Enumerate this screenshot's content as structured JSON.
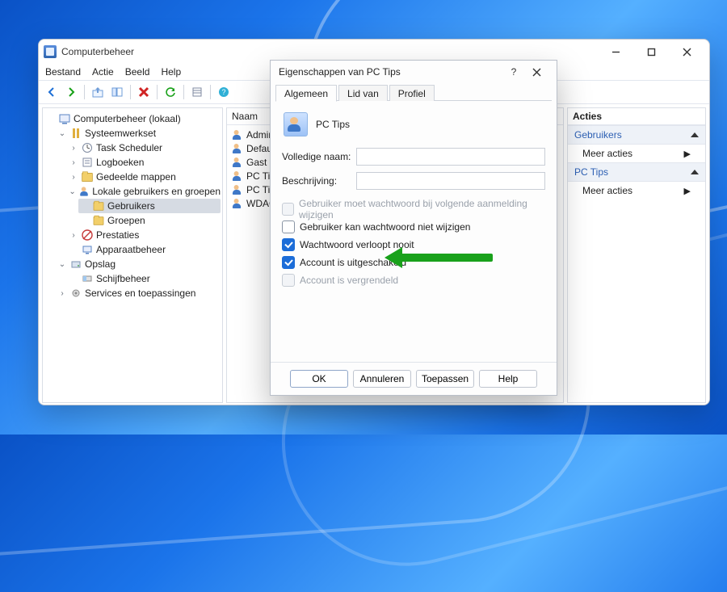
{
  "window": {
    "title": "Computerbeheer"
  },
  "menu": {
    "file": "Bestand",
    "action": "Actie",
    "view": "Beeld",
    "help": "Help"
  },
  "tree": {
    "root": "Computerbeheer (lokaal)",
    "system_tools": "Systeemwerkset",
    "task_scheduler": "Task Scheduler",
    "logs": "Logboeken",
    "shared_folders": "Gedeelde mappen",
    "local_users_groups": "Lokale gebruikers en groepen",
    "users": "Gebruikers",
    "groups": "Groepen",
    "performance": "Prestaties",
    "device_mgr": "Apparaatbeheer",
    "storage": "Opslag",
    "disk_mgmt": "Schijfbeheer",
    "services_apps": "Services en toepassingen"
  },
  "list": {
    "header": "Naam",
    "items": [
      "Admin",
      "Defaul",
      "Gast",
      "PC Tips",
      "PC Tips",
      "WDAG"
    ]
  },
  "actions": {
    "header": "Acties",
    "group1": "Gebruikers",
    "group2": "PC Tips",
    "more": "Meer acties"
  },
  "dialog": {
    "title": "Eigenschappen van PC Tips",
    "tabs": {
      "general": "Algemeen",
      "member_of": "Lid van",
      "profile": "Profiel"
    },
    "user_name": "PC Tips",
    "full_name_label": "Volledige naam:",
    "full_name_value": "",
    "description_label": "Beschrijving:",
    "description_value": "",
    "chk_change_next": "Gebruiker moet wachtwoord bij volgende aanmelding wijzigen",
    "chk_cannot_change": "Gebruiker kan wachtwoord niet wijzigen",
    "chk_never_expires": "Wachtwoord verloopt nooit",
    "chk_disabled": "Account is uitgeschakeld",
    "chk_locked": "Account is vergrendeld",
    "btn_ok": "OK",
    "btn_cancel": "Annuleren",
    "btn_apply": "Toepassen",
    "btn_help": "Help"
  }
}
